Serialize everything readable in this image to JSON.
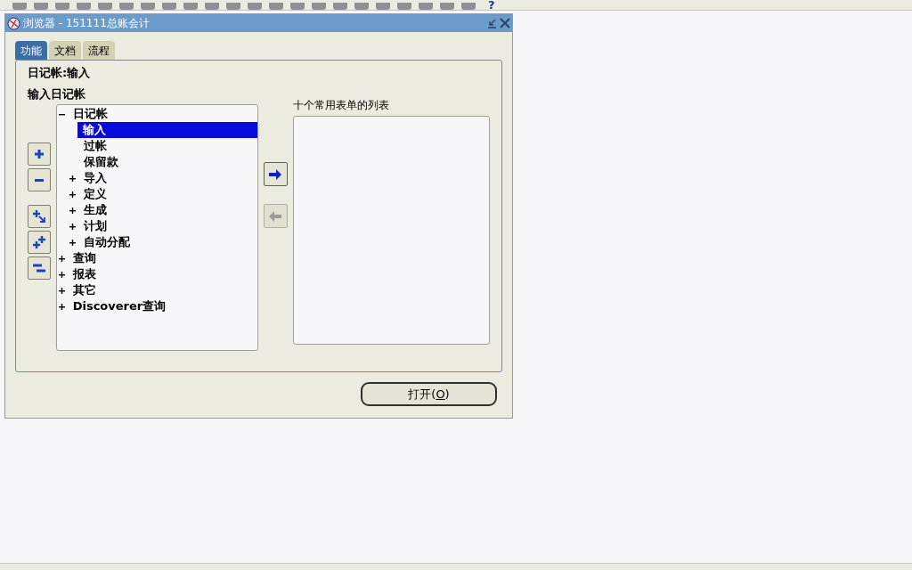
{
  "toolbar": {
    "help": "?"
  },
  "window": {
    "title": "浏览器 - 151111总账会计"
  },
  "tabs": [
    {
      "label": "功能",
      "selected": true
    },
    {
      "label": "文档",
      "selected": false
    },
    {
      "label": "流程",
      "selected": false
    }
  ],
  "heading": "日记帐:输入",
  "subheading": "输入日记帐",
  "tree": [
    {
      "label": "日记帐",
      "expanded": true,
      "selected": false,
      "children": [
        {
          "label": "输入",
          "selected": true
        },
        {
          "label": "过帐",
          "selected": false
        },
        {
          "label": "保留款",
          "selected": false
        },
        {
          "label": "导入",
          "expanded": false,
          "selected": false
        },
        {
          "label": "定义",
          "expanded": false,
          "selected": false
        },
        {
          "label": "生成",
          "expanded": false,
          "selected": false
        },
        {
          "label": "计划",
          "expanded": false,
          "selected": false
        },
        {
          "label": "自动分配",
          "expanded": false,
          "selected": false
        }
      ]
    },
    {
      "label": "查询",
      "expanded": false,
      "selected": false
    },
    {
      "label": "报表",
      "expanded": false,
      "selected": false
    },
    {
      "label": "其它",
      "expanded": false,
      "selected": false
    },
    {
      "label": "Discoverer查询",
      "expanded": false,
      "selected": false
    }
  ],
  "move_buttons": [
    {
      "kind": "add",
      "disabled": false
    },
    {
      "kind": "remove",
      "disabled": true
    }
  ],
  "favorites": {
    "label": "十个常用表单的列表"
  },
  "open_button": {
    "label_parts": [
      "打开(",
      "O",
      ")"
    ]
  }
}
